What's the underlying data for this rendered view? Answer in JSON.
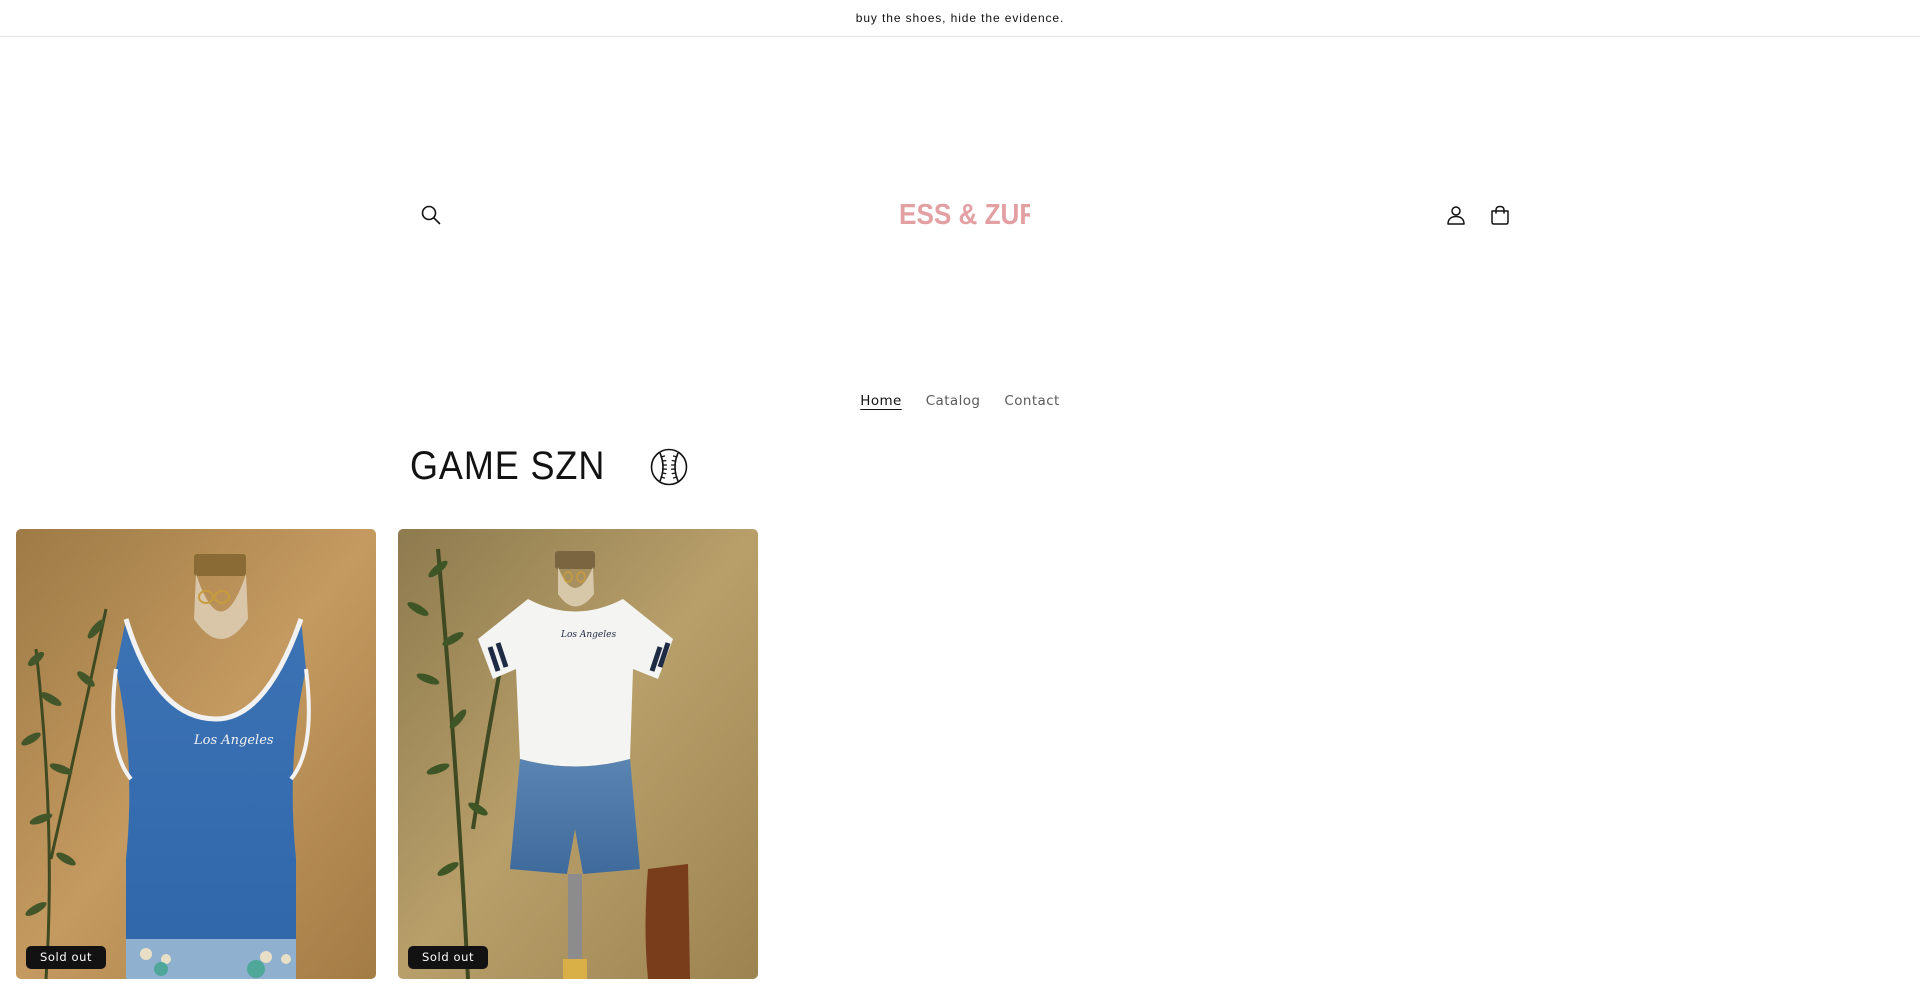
{
  "announcement": {
    "text": "buy the shoes, hide the evidence."
  },
  "header": {
    "logo_text": "JESS & ZURI",
    "logo_color": "#e3a0a3",
    "icons": [
      "search-icon",
      "account-icon",
      "cart-icon"
    ]
  },
  "nav": {
    "items": [
      {
        "label": "Home",
        "active": true
      },
      {
        "label": "Catalog",
        "active": false
      },
      {
        "label": "Contact",
        "active": false
      }
    ]
  },
  "collection": {
    "title": "GAME SZN",
    "title_icon": "baseball-icon",
    "products": [
      {
        "image_alt": "Blue Los Angeles ribbed tank top on mannequin",
        "badge": "Sold out",
        "image_text": "Los Angeles"
      },
      {
        "image_alt": "White Los Angeles baby tee with striped sleeves and denim shorts",
        "badge": "Sold out",
        "image_text": "Los Angeles"
      }
    ]
  }
}
